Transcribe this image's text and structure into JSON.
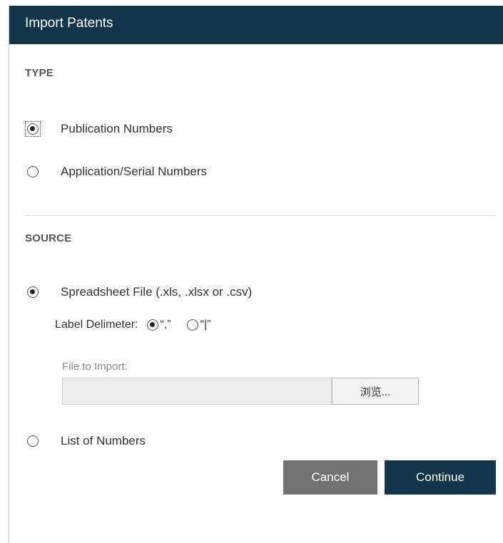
{
  "dialog": {
    "title": "Import Patents"
  },
  "type_section": {
    "heading": "TYPE",
    "options": [
      {
        "label": "Publication Numbers",
        "checked": true
      },
      {
        "label": "Application/Serial Numbers",
        "checked": false
      }
    ]
  },
  "source_section": {
    "heading": "SOURCE",
    "spreadsheet_option": {
      "label": "Spreadsheet File (.xls, .xlsx or .csv)",
      "checked": true
    },
    "delimiter": {
      "label": "Label Delimeter:",
      "options": [
        {
          "label": "“,”",
          "checked": true
        },
        {
          "label": "“|”",
          "checked": false
        }
      ]
    },
    "file_import": {
      "label": "File to Import:",
      "value": "",
      "browse_label": "浏览..."
    },
    "list_option": {
      "label": "List of Numbers",
      "checked": false
    }
  },
  "actions": {
    "cancel_label": "Cancel",
    "continue_label": "Continue"
  },
  "colors": {
    "header_bg": "#13364b",
    "continue_bg": "#13364b",
    "cancel_bg": "#727272"
  }
}
